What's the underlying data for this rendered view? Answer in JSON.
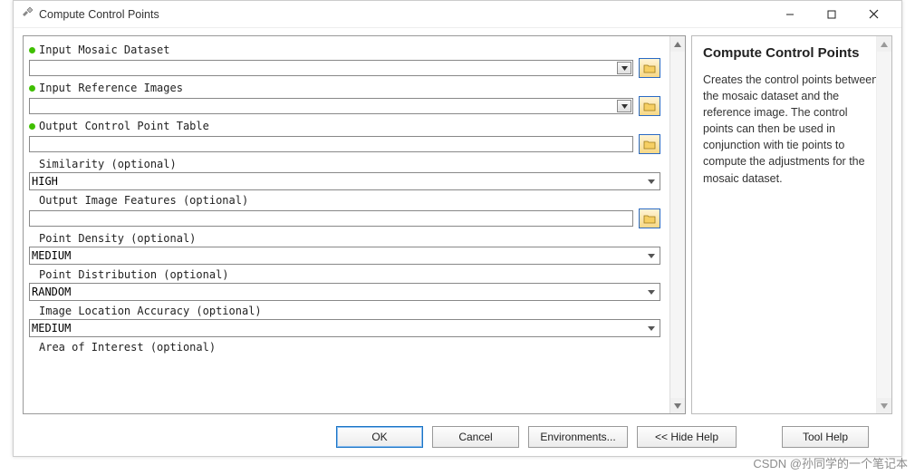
{
  "window": {
    "title": "Compute Control Points"
  },
  "fields": {
    "mosaic": {
      "label": "Input Mosaic Dataset",
      "value": ""
    },
    "reference": {
      "label": "Input Reference Images",
      "value": ""
    },
    "output_table": {
      "label": "Output Control Point Table",
      "value": ""
    },
    "similarity": {
      "label": "Similarity (optional)",
      "value": "HIGH"
    },
    "output_features": {
      "label": "Output Image Features (optional)",
      "value": ""
    },
    "density": {
      "label": "Point Density (optional)",
      "value": "MEDIUM"
    },
    "distribution": {
      "label": "Point Distribution (optional)",
      "value": "RANDOM"
    },
    "accuracy": {
      "label": "Image Location Accuracy (optional)",
      "value": "MEDIUM"
    },
    "aoi": {
      "label": "Area of Interest (optional)"
    }
  },
  "help": {
    "title": "Compute Control Points",
    "body": "Creates the control points between the mosaic dataset and the reference image. The control points can then be used in conjunction with tie points to compute the adjustments for the mosaic dataset."
  },
  "buttons": {
    "ok": "OK",
    "cancel": "Cancel",
    "env": "Environments...",
    "hide": "<< Hide Help",
    "toolhelp": "Tool Help"
  },
  "watermark": "CSDN @孙同学的一个笔记本"
}
